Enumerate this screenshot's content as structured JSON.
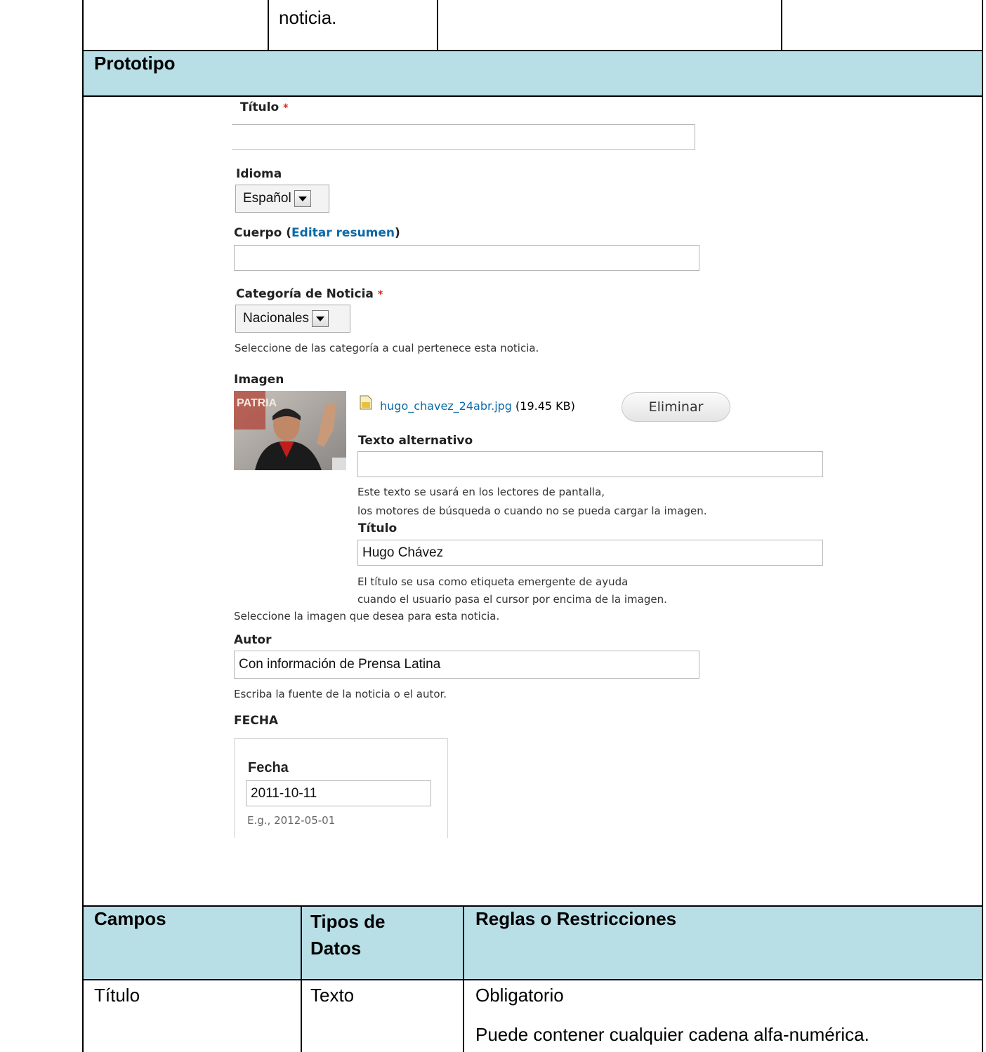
{
  "top_row": {
    "cell2": "noticia."
  },
  "prototipo_label": "Prototipo",
  "form": {
    "titulo_label": "Título",
    "required_mark": "*",
    "idioma_label": "Idioma",
    "idioma_value": "Español",
    "cuerpo_label": "Cuerpo (",
    "cuerpo_link": "Editar resumen",
    "cuerpo_close": ")",
    "categoria_label": "Categoría de Noticia",
    "categoria_value": "Nacionales",
    "categoria_desc": "Seleccione de las categoría a cual pertenece esta noticia.",
    "imagen_label": "Imagen",
    "file_name": "hugo_chavez_24abr.jpg",
    "file_size": "(19.45 KB)",
    "eliminar_button": "Eliminar",
    "alt_label": "Texto alternativo",
    "alt_desc_1": "Este texto se usará en los lectores de pantalla,",
    "alt_desc_2": "los motores de búsqueda o cuando no se pueda cargar la imagen.",
    "img_title_label": "Título",
    "img_title_value": "Hugo Chávez",
    "img_title_desc_1": "El título se usa como etiqueta emergente de ayuda",
    "img_title_desc_2": "cuando el usuario pasa el cursor por encima de la imagen.",
    "imagen_desc": "Seleccione la imagen que desea para esta noticia.",
    "autor_label": "Autor",
    "autor_value": "Con información de Prensa Latina",
    "autor_desc": "Escriba la fuente de la noticia o el autor.",
    "fecha_group_label": "FECHA",
    "fecha_label": "Fecha",
    "fecha_value": "2011-10-11",
    "fecha_example": "E.g., 2012-05-01",
    "image_watermark": "PATRIA"
  },
  "fields_table": {
    "headers": {
      "campos": "Campos",
      "tipos": "Tipos de Datos",
      "tipos_1": "Tipos de",
      "tipos_2": "Datos",
      "reglas": "Reglas o Restricciones"
    },
    "row": {
      "campo": "Título",
      "tipo": "Texto",
      "regla_1": "Obligatorio",
      "regla_2": "Puede contener cualquier cadena alfa-numérica."
    }
  },
  "colors": {
    "header_bg": "#b8dee6",
    "link": "#0b6aa8",
    "required": "#dd2222"
  }
}
